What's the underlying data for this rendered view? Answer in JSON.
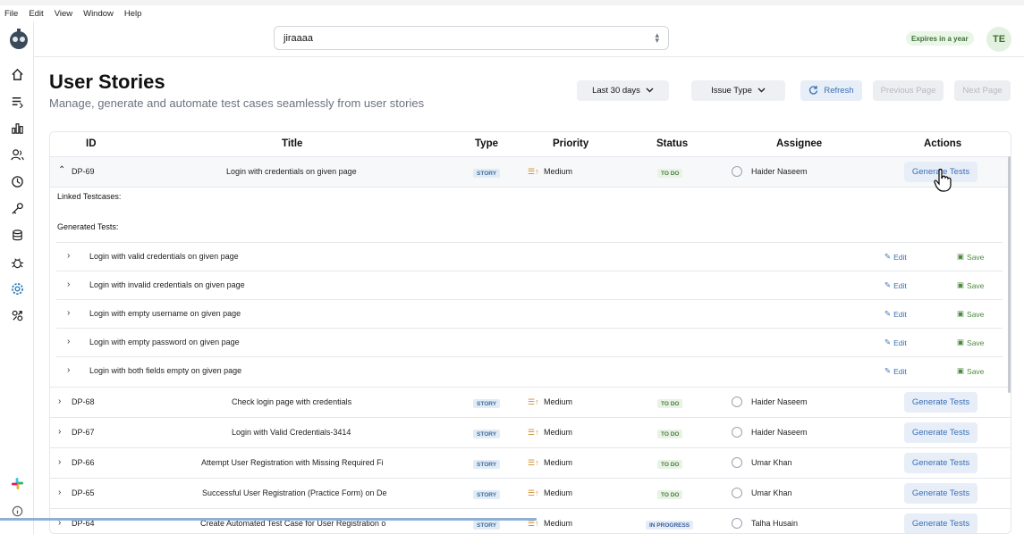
{
  "app": {
    "title": "Robonito"
  },
  "menu": [
    "File",
    "Edit",
    "View",
    "Window",
    "Help"
  ],
  "topbar": {
    "project": "jiraaaa",
    "expires": "Expires in a year",
    "avatar": "TE"
  },
  "sidebar": {
    "icons": [
      "home-icon",
      "list-icon",
      "chart-icon",
      "users-icon",
      "clock-icon",
      "key-icon",
      "database-icon",
      "bug-icon",
      "settings-icon",
      "integration-icon",
      "slack-icon",
      "info-icon"
    ]
  },
  "page": {
    "title": "User Stories",
    "subtitle": "Manage, generate and automate test cases seamlessly from user stories"
  },
  "filters": {
    "date": "Last 30 days",
    "issue_type": "Issue Type",
    "refresh": "Refresh",
    "prev": "Previous Page",
    "next": "Next Page"
  },
  "table": {
    "headers": {
      "id": "ID",
      "title": "Title",
      "type": "Type",
      "priority": "Priority",
      "status": "Status",
      "assignee": "Assignee",
      "actions": "Actions"
    },
    "expanded": {
      "id": "DP-69",
      "title": "Login with credentials on given page",
      "type": "STORY",
      "priority": "Medium",
      "status": "TO DO",
      "assignee": "Haider Naseem",
      "action": "Generate Tests",
      "linked_label": "Linked Testcases:",
      "generated_label": "Generated Tests:",
      "tests": [
        "Login with valid credentials on given page",
        "Login with invalid credentials on given page",
        "Login with empty username on given page",
        "Login with empty password on given page",
        "Login with both fields empty on given page"
      ],
      "edit_label": "Edit",
      "save_label": "Save"
    },
    "rows": [
      {
        "id": "DP-68",
        "title": "Check login page with credentials",
        "type": "STORY",
        "priority": "Medium",
        "status": "TO DO",
        "assignee": "Haider Naseem",
        "action": "Generate Tests"
      },
      {
        "id": "DP-67",
        "title": "Login with Valid Credentials-3414",
        "type": "STORY",
        "priority": "Medium",
        "status": "TO DO",
        "assignee": "Haider Naseem",
        "action": "Generate Tests"
      },
      {
        "id": "DP-66",
        "title": "Attempt User Registration with Missing Required Fi",
        "type": "STORY",
        "priority": "Medium",
        "status": "TO DO",
        "assignee": "Umar Khan",
        "action": "Generate Tests"
      },
      {
        "id": "DP-65",
        "title": "Successful User Registration (Practice Form) on De",
        "type": "STORY",
        "priority": "Medium",
        "status": "TO DO",
        "assignee": "Umar Khan",
        "action": "Generate Tests"
      },
      {
        "id": "DP-64",
        "title": "Create Automated Test Case for User Registration o",
        "type": "STORY",
        "priority": "Medium",
        "status": "IN PROGRESS",
        "assignee": "Talha Husain",
        "action": "Generate Tests"
      }
    ]
  }
}
